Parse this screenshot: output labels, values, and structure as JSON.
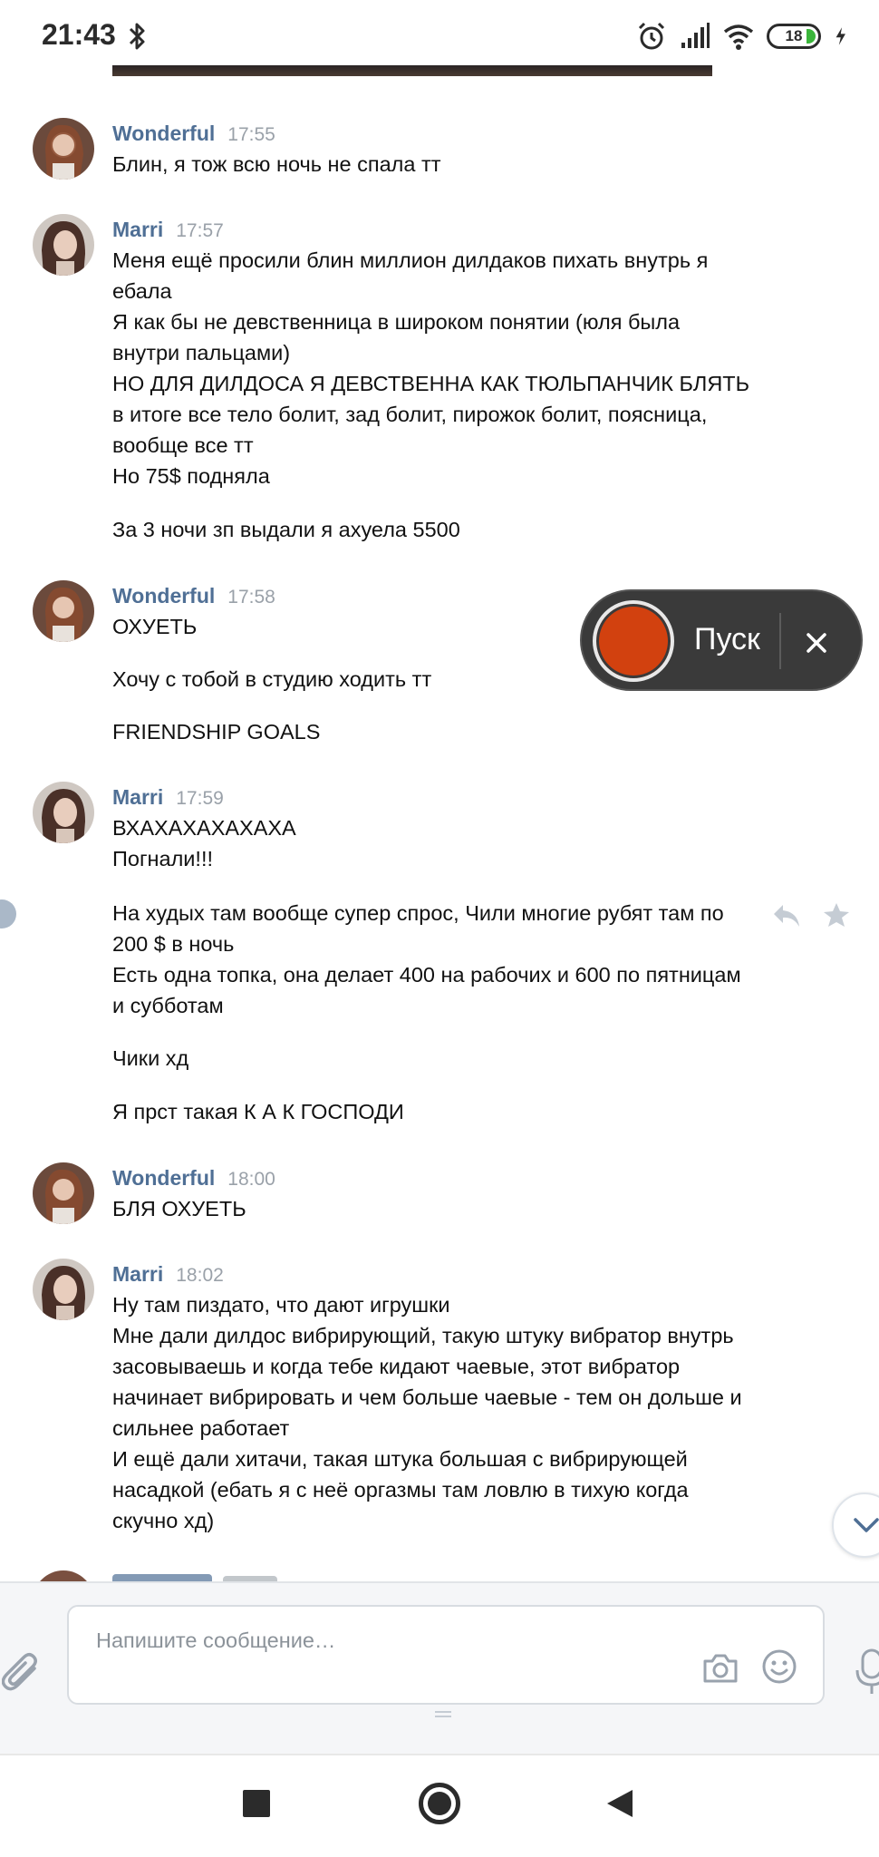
{
  "status_bar": {
    "time": "21:43",
    "battery_level": "18",
    "battery_color": "#3ab53a"
  },
  "messages": [
    {
      "author": "Wonderful",
      "time": "17:55",
      "text": "Блин, я тож всю ночь не спала тт"
    },
    {
      "author": "Marri",
      "time": "17:57",
      "text": "Меня ещё просили блин миллион дилдаков пихать внутрь я\nебала\nЯ как бы не девственница в широком понятии (юля была\nвнутри пальцами)\nНО ДЛЯ ДИЛДОСА Я ДЕВСТВЕННА КАК ТЮЛЬПАНЧИК БЛЯТЬ\nв итоге все тело болит, зад болит, пирожок болит, поясница,\nвообще все тт\nНо 75$ подняла",
      "text2": "За 3 ночи зп выдали я ахуела 5500"
    },
    {
      "author": "Wonderful",
      "time": "17:58",
      "text": "ОХУЕТЬ",
      "text2": "Хочу с тобой в студию ходить тт",
      "text3": "FRIENDSHIP GOALS"
    },
    {
      "author": "Marri",
      "time": "17:59",
      "text": "ВХАХАХАХАХАХА\nПогнали!!!",
      "text2": "На худых там вообще супер спрос, Чили многие рубят там по\n200 $ в ночь\nЕсть одна топка, она делает 400 на рабочих и 600 по пятницам\nи субботам",
      "text3": "Чики хд",
      "text4": "Я прст такая К А К ГОСПОДИ"
    },
    {
      "author": "Wonderful",
      "time": "18:00",
      "text": "БЛЯ ОХУЕТЬ"
    },
    {
      "author": "Marri",
      "time": "18:02",
      "text": "Ну там пиздато, что дают игрушки\nМне дали дилдос вибрирующий, такую штуку вибратор внутрь\nзасовываешь и когда тебе кидают чаевые, этот вибратор\nначинает вибрировать и чем больше чаевые - тем он дольше и\nсильнее работает\nИ ещё дали хитачи, такая штука большая с вибрирующей\nнасадкой (ебать я с неё оргазмы там ловлю в тихую когда\nскучно хд)"
    }
  ],
  "record_widget": {
    "label": "Пуск",
    "button_color": "#d2410f"
  },
  "composer": {
    "placeholder": "Напишите сообщение…"
  },
  "colors": {
    "author": "#4f6f95",
    "timestamp": "#9aa1a9",
    "accent": "#4f6f95"
  }
}
